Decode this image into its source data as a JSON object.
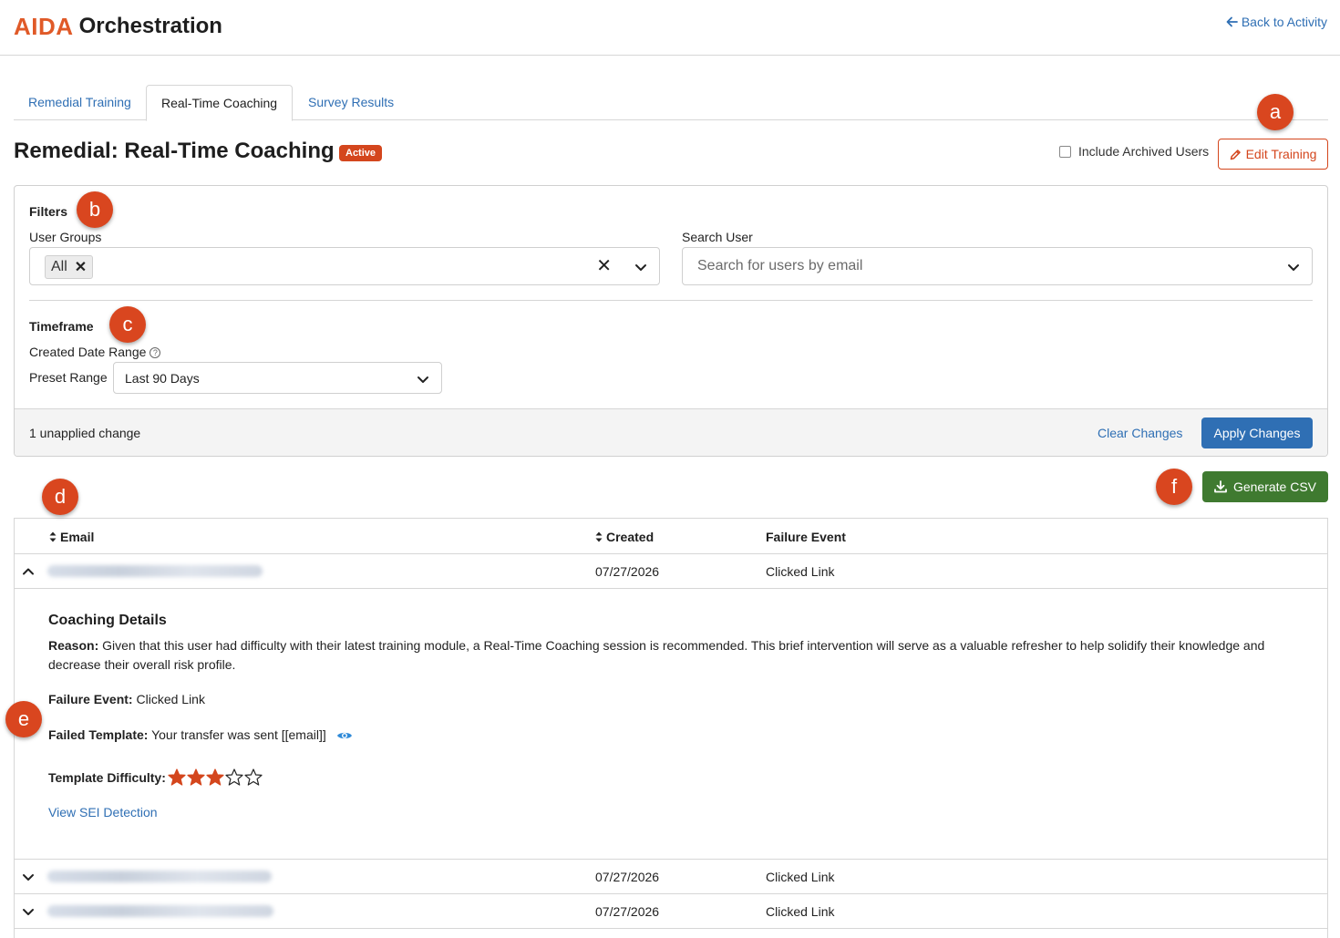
{
  "header": {
    "brand": "AIDA",
    "product": "Orchestration",
    "back_link": "Back to Activity"
  },
  "tabs": [
    {
      "label": "Remedial Training",
      "active": false
    },
    {
      "label": "Real-Time Coaching",
      "active": true
    },
    {
      "label": "Survey Results",
      "active": false
    }
  ],
  "page": {
    "title": "Remedial: Real-Time Coaching",
    "status_badge": "Active",
    "include_archived_label": "Include Archived Users",
    "edit_button": "Edit Training"
  },
  "markers": {
    "a": "a",
    "b": "b",
    "c": "c",
    "d": "d",
    "e": "e",
    "f": "f"
  },
  "filters": {
    "title": "Filters",
    "user_groups_label": "User Groups",
    "user_groups_chip": "All",
    "search_user_label": "Search User",
    "search_user_placeholder": "Search for users by email",
    "timeframe_title": "Timeframe",
    "created_date_range_label": "Created Date Range",
    "preset_range_label": "Preset Range",
    "preset_range_value": "Last 90 Days",
    "unapplied_text": "1 unapplied change",
    "clear_changes": "Clear Changes",
    "apply_changes": "Apply Changes"
  },
  "actions": {
    "generate_csv": "Generate CSV"
  },
  "table": {
    "columns": [
      "Email",
      "Created",
      "Failure Event"
    ],
    "rows": [
      {
        "created": "07/27/2026",
        "failure_event": "Clicked Link",
        "expanded": true
      },
      {
        "created": "07/27/2026",
        "failure_event": "Clicked Link",
        "expanded": false
      },
      {
        "created": "07/27/2026",
        "failure_event": "Clicked Link",
        "expanded": false
      }
    ]
  },
  "details": {
    "title": "Coaching Details",
    "reason_label": "Reason:",
    "reason_text": "Given that this user had difficulty with their latest training module, a Real-Time Coaching session is recommended. This brief intervention will serve as a valuable refresher to help solidify their knowledge and decrease their overall risk profile.",
    "failure_event_label": "Failure Event:",
    "failure_event_value": "Clicked Link",
    "failed_template_label": "Failed Template:",
    "failed_template_value": "Your transfer was sent [[email]]",
    "template_difficulty_label": "Template Difficulty:",
    "template_difficulty_rating": 3,
    "template_difficulty_max": 5,
    "view_sei_link": "View SEI Detection"
  },
  "colors": {
    "brand_orange": "#e05a28",
    "accent_red": "#d4461d",
    "link_blue": "#2f6fb4",
    "csv_green": "#3f7a30",
    "marker": "#d9461f"
  }
}
